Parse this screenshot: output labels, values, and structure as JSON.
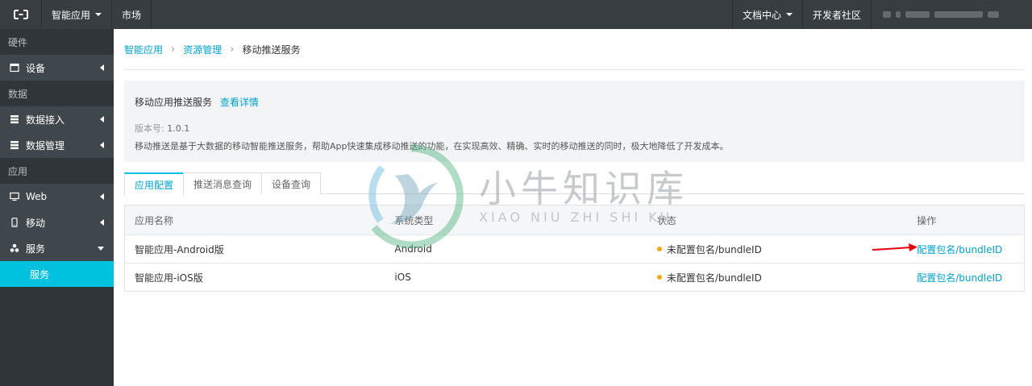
{
  "topbar": {
    "app_menu_label": "智能应用",
    "market_label": "市场",
    "docs_label": "文档中心",
    "community_label": "开发者社区"
  },
  "sidebar": {
    "groups": [
      {
        "label": "硬件"
      },
      {
        "label": "数据"
      },
      {
        "label": "应用"
      }
    ],
    "items": [
      {
        "label": "设备",
        "icon": "device-icon"
      },
      {
        "label": "数据接入",
        "icon": "data-access-icon"
      },
      {
        "label": "数据管理",
        "icon": "data-manage-icon"
      },
      {
        "label": "Web",
        "icon": "monitor-icon"
      },
      {
        "label": "移动",
        "icon": "mobile-icon"
      },
      {
        "label": "服务",
        "icon": "service-icon"
      }
    ],
    "sub_active": "服务"
  },
  "breadcrumb": {
    "items": [
      "智能应用",
      "资源管理",
      "移动推送服务"
    ]
  },
  "info": {
    "title": "移动应用推送服务",
    "detail_link": "查看详情",
    "version_label": "版本号:",
    "version_value": "1.0.1",
    "description": "移动推送是基于大数据的移动智能推送服务，帮助App快速集成移动推送的功能，在实现高效、精确、实时的移动推送的同时，极大地降低了开发成本。"
  },
  "tabs": [
    "应用配置",
    "推送消息查询",
    "设备查询"
  ],
  "table": {
    "headers": [
      "应用名称",
      "系统类型",
      "状态",
      "操作"
    ],
    "rows": [
      {
        "name": "智能应用-Android版",
        "os": "Android",
        "status": "未配置包名/bundleID",
        "action": "配置包名/bundleID"
      },
      {
        "name": "智能应用-iOS版",
        "os": "iOS",
        "status": "未配置包名/bundleID",
        "action": "配置包名/bundleID"
      }
    ]
  },
  "watermark": {
    "cn": "小牛知识库",
    "en": "XIAO NIU ZHI SHI KU"
  },
  "colors": {
    "accent": "#00c1de",
    "link": "#00a2ca",
    "topbar": "#373d41",
    "sidebar": "#2f3538",
    "status_dot": "#f5a623",
    "arrow": "#e60012"
  }
}
